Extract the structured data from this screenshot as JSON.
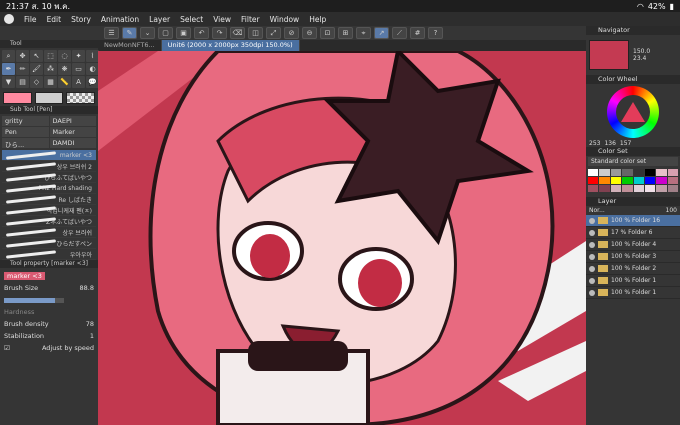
{
  "status": {
    "time": "21:37",
    "date": "ส. 10 พ.ค.",
    "battery": "42%"
  },
  "menu": [
    "File",
    "Edit",
    "Story",
    "Animation",
    "Layer",
    "Select",
    "View",
    "Filter",
    "Window",
    "Help"
  ],
  "tabs": [
    {
      "label": "NewMonNFT6..."
    },
    {
      "label": "Unit6 (2000 x 2000px 350dpi 150.0%)"
    }
  ],
  "left": {
    "tool_header": "Tool",
    "subtool_header": "Sub Tool [Pen]",
    "subtools": [
      "gritty",
      "DAEPI",
      "Pen",
      "Marker",
      "ひら...",
      "DAMDI"
    ],
    "brushes": [
      {
        "label": "marker <3"
      },
      {
        "label": "상우 브러쉬 2"
      },
      {
        "label": "ひらふてばいやつ"
      },
      {
        "label": "PR2 Hard shading"
      },
      {
        "label": "Re しばたき"
      },
      {
        "label": "작업니케재 펜(ㅈ)"
      },
      {
        "label": "Zネふてばいやつ"
      },
      {
        "label": "상우 브러쉬"
      },
      {
        "label": "ひらだすペン"
      },
      {
        "label": "우아우아"
      }
    ],
    "property_header": "Tool property [marker <3]",
    "property_name": "marker <3",
    "brush_size_label": "Brush Size",
    "brush_size": "88.8",
    "hardness_label": "Hardness",
    "brush_density_label": "Brush density",
    "brush_density": "78",
    "stabilization_label": "Stabilization",
    "stabilization": "1",
    "adjust_label": "Adjust by speed"
  },
  "right": {
    "navigator_header": "Navigator",
    "zoom": "150.0",
    "angle": "23.4",
    "color_wheel_header": "Color Wheel",
    "rgb": [
      "253",
      "136",
      "157"
    ],
    "color_set_header": "Color Set",
    "color_set_name": "Standard color set",
    "layer_header": "Layer",
    "blend": "Nor...",
    "opacity": "100",
    "layers": [
      {
        "pct": "100 %",
        "name": "Folder 16"
      },
      {
        "pct": "17 %",
        "name": "Folder 6"
      },
      {
        "pct": "100 %",
        "name": "Folder 4"
      },
      {
        "pct": "100 %",
        "name": "Folder 3"
      },
      {
        "pct": "100 %",
        "name": "Folder 2"
      },
      {
        "pct": "100 %",
        "name": "Folder 1"
      },
      {
        "pct": "100 %",
        "name": "Folder 1"
      }
    ]
  },
  "colors": {
    "main": "#ff8aa0",
    "sub": "#cfcfcf",
    "accent": "#4a6fa0"
  }
}
